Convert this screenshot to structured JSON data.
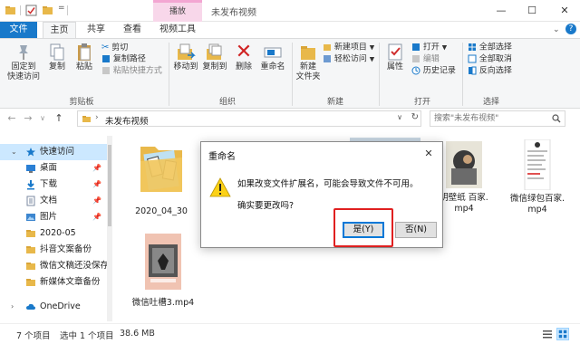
{
  "window": {
    "title": "未发布视频",
    "contextual_tab": "播放",
    "minimize_icon": "—",
    "maximize_icon": "☐",
    "close_icon": "✕"
  },
  "tabs": {
    "file": "文件",
    "home": "主页",
    "share": "共享",
    "view": "查看",
    "video_tools": "视频工具"
  },
  "ribbon": {
    "clipboard": {
      "pin_label_1": "固定到",
      "pin_label_2": "快速访问",
      "copy": "复制",
      "paste": "粘贴",
      "cut": "剪切",
      "copy_path": "复制路径",
      "paste_shortcut": "粘贴快捷方式",
      "group_label": "剪贴板"
    },
    "organize": {
      "move_to": "移动到",
      "copy_to": "复制到",
      "delete": "删除",
      "rename": "重命名",
      "group_label": "组织"
    },
    "new": {
      "new_folder_1": "新建",
      "new_folder_2": "文件夹",
      "new_item": "新建项目",
      "easy_access": "轻松访问",
      "group_label": "新建"
    },
    "open": {
      "properties": "属性",
      "open": "打开",
      "edit": "编辑",
      "history": "历史记录",
      "group_label": "打开"
    },
    "select": {
      "select_all": "全部选择",
      "select_none": "全部取消",
      "invert": "反向选择",
      "group_label": "选择"
    }
  },
  "address": {
    "path": "未发布视频",
    "search_placeholder": "搜索\"未发布视频\""
  },
  "nav": {
    "items": [
      {
        "label": "快速访问",
        "pinned": false
      },
      {
        "label": "桌面",
        "pinned": true
      },
      {
        "label": "下载",
        "pinned": true
      },
      {
        "label": "文档",
        "pinned": true
      },
      {
        "label": "图片",
        "pinned": true
      },
      {
        "label": "2020-05",
        "pinned": false
      },
      {
        "label": "抖音文案备份",
        "pinned": false
      },
      {
        "label": "微信文稿还没保存",
        "pinned": false
      },
      {
        "label": "新媒体文章备份",
        "pinned": false
      },
      {
        "label": "OneDrive",
        "pinned": false
      }
    ],
    "pin_glyph": "📌"
  },
  "files": [
    {
      "name": "2020_04_30"
    },
    {
      "name": "明壁纸 百家.",
      "name2": "mp4"
    },
    {
      "name": "微信绿包百家.",
      "name2": "mp4"
    },
    {
      "name": "微信吐槽3.mp4"
    }
  ],
  "status": {
    "count": "7 个项目",
    "selected": "选中 1 个项目",
    "size": "38.6 MB"
  },
  "dialog": {
    "title": "重命名",
    "message": "如果改变文件扩展名，可能会导致文件不可用。",
    "question": "确实要更改吗?",
    "yes": "是(Y)",
    "no": "否(N)",
    "close_icon": "✕"
  }
}
